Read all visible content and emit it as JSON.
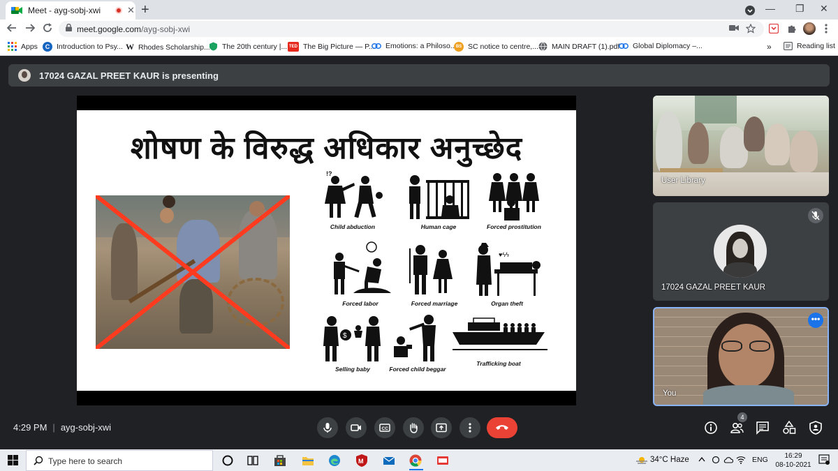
{
  "browser": {
    "tab_title": "Meet - ayg-sobj-xwi",
    "tab_close": "✕",
    "new_tab": "+",
    "url_host": "meet.google.com",
    "url_path": "/ayg-sobj-xwi",
    "window_controls": [
      "—",
      "❐",
      "✕"
    ],
    "bookmarks": [
      {
        "label": "Apps",
        "icon": "apps-grid-icon",
        "color": "#1a73e8"
      },
      {
        "label": "Introduction to Psy...",
        "icon": "c-icon",
        "color": "#1565c0"
      },
      {
        "label": "Rhodes Scholarship...",
        "icon": "w-icon",
        "color": "#000000"
      },
      {
        "label": "The 20th century |...",
        "icon": "shield-icon",
        "color": "#1aa260"
      },
      {
        "label": "The Big Picture — P...",
        "icon": "ted-icon",
        "color": "#e62b1e"
      },
      {
        "label": "Emotions: a Philoso...",
        "icon": "link-icon",
        "color": "#1a73e8"
      },
      {
        "label": "SC notice to centre,...",
        "icon": "news-icon",
        "color": "#f0a020"
      },
      {
        "label": "MAIN DRAFT (1).pdf",
        "icon": "globe-icon",
        "color": "#5f6368"
      },
      {
        "label": "Global Diplomacy –...",
        "icon": "link-icon",
        "color": "#1a73e8"
      }
    ],
    "overflow_chevron": "»",
    "reading_list": "Reading list"
  },
  "meet": {
    "presenting_text": "17024 GAZAL PREET KAUR is presenting",
    "slide": {
      "title": "शोषण के विरुद्ध अधिकार अनुच्छेद",
      "icons": [
        {
          "caption": "Child abduction"
        },
        {
          "caption": "Human cage"
        },
        {
          "caption": "Forced prostitution"
        },
        {
          "caption": "Forced labor"
        },
        {
          "caption": "Forced marriage"
        },
        {
          "caption": "Organ theft"
        },
        {
          "caption": "Selling baby"
        },
        {
          "caption": "Forced child beggar"
        },
        {
          "caption": "Trafficking boat"
        }
      ]
    },
    "tiles": [
      {
        "name": "User Library"
      },
      {
        "name": "17024 GAZAL PREET KAUR"
      },
      {
        "name": "You"
      }
    ],
    "more_options": "•••",
    "time": "4:29 PM",
    "separator": "|",
    "meeting_code": "ayg-sobj-xwi",
    "participants_count": "4",
    "accent_red": "#ea4335",
    "accent_blue": "#8ab4f8"
  },
  "taskbar": {
    "search_placeholder": "Type here to search",
    "weather": "34°C  Haze",
    "language": "ENG",
    "time": "16:29",
    "date": "08-10-2021"
  }
}
